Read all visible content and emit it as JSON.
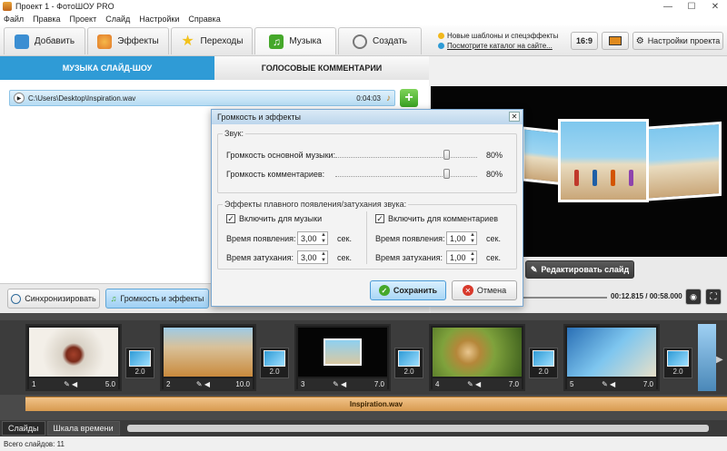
{
  "window": {
    "title": "Проект 1 - ФотоШОУ PRO",
    "min": "—",
    "max": "☐",
    "close": "✕"
  },
  "menu": [
    "Файл",
    "Правка",
    "Проект",
    "Слайд",
    "Настройки",
    "Справка"
  ],
  "tabs": [
    {
      "label": "Добавить",
      "icon": "add-photo-icon",
      "color": "#3b8ed2"
    },
    {
      "label": "Эффекты",
      "icon": "effects-icon",
      "color": "#e27b2a"
    },
    {
      "label": "Переходы",
      "icon": "star-icon",
      "color": "#f2c21c"
    },
    {
      "label": "Музыка",
      "icon": "music-icon",
      "color": "#45a82a"
    },
    {
      "label": "Создать",
      "icon": "film-reel-icon",
      "color": "#777777"
    }
  ],
  "news": {
    "line1": "Новые шаблоны и спецэффекты",
    "line2": "Посмотрите каталог на сайте..."
  },
  "aspect": "16:9",
  "project_settings": "Настройки проекта",
  "subtabs": {
    "music": "МУЗЫКА СЛАЙД-ШОУ",
    "voice": "ГОЛОСОВЫЕ КОММЕНТАРИИ"
  },
  "track": {
    "path": "C:\\Users\\Desktop\\Inspiration.wav",
    "duration": "0:04:03"
  },
  "buttons": {
    "sync": "Синхронизировать",
    "volume_effects": "Громкость и эффекты",
    "edit_slide": "Редактировать слайд"
  },
  "playback": {
    "time": "00:12.815 / 00:58.000"
  },
  "dialog": {
    "title": "Громкость и эффекты",
    "sound_group": "Звук:",
    "music_volume_label": "Громкость основной музыки:",
    "music_volume_value": "80%",
    "music_volume_level": 0.8,
    "comment_volume_label": "Громкость комментариев:",
    "comment_volume_value": "80%",
    "comment_volume_level": 0.8,
    "fade_group": "Эффекты плавного появления/затухания звука:",
    "music_enable": "Включить для музыки",
    "comment_enable": "Включить для комментариев",
    "fade_in_label": "Время появления:",
    "fade_out_label": "Время затухания:",
    "music_fade_in": "3,00",
    "music_fade_out": "3,00",
    "comment_fade_in": "1,00",
    "comment_fade_out": "1,00",
    "unit": "сек.",
    "save": "Сохранить",
    "cancel": "Отмена"
  },
  "slides": [
    {
      "num": "1",
      "dur": "5.0",
      "trans": "2.0"
    },
    {
      "num": "2",
      "dur": "10.0",
      "trans": "2.0"
    },
    {
      "num": "3",
      "dur": "7.0",
      "trans": "2.0"
    },
    {
      "num": "4",
      "dur": "7.0",
      "trans": "2.0"
    },
    {
      "num": "5",
      "dur": "7.0",
      "trans": "2.0"
    }
  ],
  "audio_track": "Inspiration.wav",
  "view_tabs": {
    "slides": "Слайды",
    "timeline": "Шкала времени"
  },
  "status": "Всего слайдов: 11"
}
